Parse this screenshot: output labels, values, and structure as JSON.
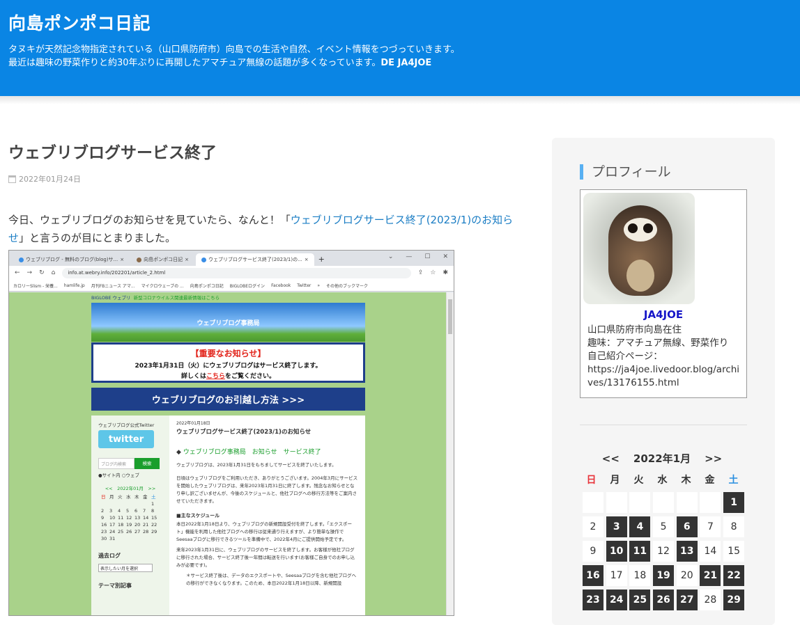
{
  "header": {
    "title": "向島ポンポコ日記",
    "desc1": "タヌキが天然記念物指定されている（山口県防府市）向島での生活や自然、イベント情報をつづっていきます。",
    "desc2": "最近は趣味の野菜作りと約30年ぶりに再開したアマチュア無線の話題が多くなっています。",
    "desc2_bold": "DE JA4JOE",
    "bg_color": "#0a85e4"
  },
  "post": {
    "title": "ウェブリブログサービス終了",
    "date": "2022年01月24日",
    "text_before": "今日、ウェブリブログのお知らせを見ていたら、なんと！「",
    "link": "ウェブリブログサービス終了(2023/1)のお知らせ",
    "text_after": "」と言うのが目にとまりました。"
  },
  "screenshot": {
    "tab1": "ウェブリブログ - 無料のブログ(blog)サ...",
    "tab2": "向島ポンポコ日記",
    "tab3": "ウェブリブログサービス終了(2023/1)の...",
    "url": "info.at.webry.info/202201/article_2.html",
    "bookmarks": [
      "カロリーSlism - 栄養...",
      "hamlife.jp",
      "月刊FBニュース アマ...",
      "マイクロウェーブの ...",
      "向島ポンポコ日記",
      "BIGLOBEログイン",
      "Facebook",
      "Twitter",
      "その他のブックマーク"
    ],
    "top_bar": "BIGLOBE ウェブリ",
    "top_link": "新型コロナウイルス関連最新情報はこちら",
    "banner": "ウェブリブログ事務局",
    "notice_head": "【重要なお知らせ】",
    "notice_line1": "2023年1月31日（火）にウェブリブログはサービス終了します。",
    "notice_line2a": "詳しくは",
    "notice_link": "こちら",
    "notice_line2b": "をご覧ください。",
    "move": "ウェブリブログのお引越し方法 >>>",
    "side_twitter": "ウェブリブログ公式Twitter",
    "twitter_logo": "twitter",
    "search_placeholder": "ブログ内検索",
    "search_btn": "検索",
    "radio1": "●サイト内",
    "radio2": "○ウェブ",
    "mini_cal_head": "<<　2022年01月　>>",
    "mini_dow": [
      "日",
      "月",
      "火",
      "水",
      "木",
      "金",
      "土"
    ],
    "mini_weeks": [
      [
        "",
        "",
        "",
        "",
        "",
        "",
        "1"
      ],
      [
        "2",
        "3",
        "4",
        "5",
        "6",
        "7",
        "8"
      ],
      [
        "9",
        "10",
        "11",
        "12",
        "13",
        "14",
        "15"
      ],
      [
        "16",
        "17",
        "18",
        "19",
        "20",
        "21",
        "22"
      ],
      [
        "23",
        "24",
        "25",
        "26",
        "27",
        "28",
        "29"
      ],
      [
        "30",
        "31",
        "",
        "",
        "",
        "",
        ""
      ]
    ],
    "archive": "過去ログ",
    "archive_select": "表示したい月を選択",
    "theme": "テーマ別記事",
    "article_date": "2022年01月18日",
    "article_title": "ウェブリブログサービス終了(2023/1)のお知らせ",
    "article_tags": "ウェブリブログ事務局　お知らせ　サービス終了",
    "p1": "ウェブリブログは、2023年1月31日をもちましてサービスを終了いたします。",
    "p2": "日頃はウェブリブログをご利用いただき、ありがとうございます。2004年3月にサービスを開始したウェブリブログは、来年2023年1月31日に終了します。残念なお知らせとなり申し訳ございませんが、今後のスケジュールと、他社ブログへの移行方法等をご案内させていただきます。",
    "sched": "■主なスケジュール",
    "p3": "本日2022年1月18日より、ウェブリブログの新規開設受付を終了します。「エクスポート」機能を利用した他社ブログへの移行は従来通り行えますが、より簡単な操作でSeesaaブログに移行できるツールを準備中で、2022年4月にご提供開始予定です。",
    "p4": "来年2023年1月31日に、ウェブリブログのサービスを終了します。お客様が他社ブログに移行された場合、サービス終了後一年間は転送を行います(お客様ご自身でのお申し込みが必要です)。",
    "p5": "＊サービス終了後は、データのエクスポートや、Seesaaブログを含む他社ブログへの移行ができなくなります。このため、本日2022年1月18日以降、新規開設"
  },
  "sidebar": {
    "heading": "プロフィール",
    "name": "JA4JOE",
    "info1": "山口県防府市向島在住",
    "info2": "趣味：アマチュア無線、野菜作り",
    "info3": "自己紹介ページ：",
    "info4": "https://ja4joe.livedoor.blog/archives/13176155.html",
    "accent_color": "#58b0f2"
  },
  "calendar": {
    "prev": "<<",
    "title": "2022年1月",
    "next": ">>",
    "dow": [
      "日",
      "月",
      "火",
      "水",
      "木",
      "金",
      "土"
    ],
    "days": [
      {
        "d": "",
        "on": false
      },
      {
        "d": "",
        "on": false
      },
      {
        "d": "",
        "on": false
      },
      {
        "d": "",
        "on": false
      },
      {
        "d": "",
        "on": false
      },
      {
        "d": "",
        "on": false
      },
      {
        "d": "1",
        "on": true
      },
      {
        "d": "2",
        "on": false
      },
      {
        "d": "3",
        "on": true
      },
      {
        "d": "4",
        "on": true
      },
      {
        "d": "5",
        "on": false
      },
      {
        "d": "6",
        "on": true
      },
      {
        "d": "7",
        "on": false
      },
      {
        "d": "8",
        "on": false
      },
      {
        "d": "9",
        "on": false
      },
      {
        "d": "10",
        "on": true
      },
      {
        "d": "11",
        "on": true
      },
      {
        "d": "12",
        "on": false
      },
      {
        "d": "13",
        "on": true
      },
      {
        "d": "14",
        "on": false
      },
      {
        "d": "15",
        "on": false
      },
      {
        "d": "16",
        "on": true
      },
      {
        "d": "17",
        "on": false
      },
      {
        "d": "18",
        "on": false
      },
      {
        "d": "19",
        "on": true
      },
      {
        "d": "20",
        "on": false
      },
      {
        "d": "21",
        "on": true
      },
      {
        "d": "22",
        "on": true
      },
      {
        "d": "23",
        "on": true
      },
      {
        "d": "24",
        "on": true
      },
      {
        "d": "25",
        "on": true
      },
      {
        "d": "26",
        "on": true
      },
      {
        "d": "27",
        "on": true
      },
      {
        "d": "28",
        "on": false
      },
      {
        "d": "29",
        "on": true
      }
    ]
  }
}
